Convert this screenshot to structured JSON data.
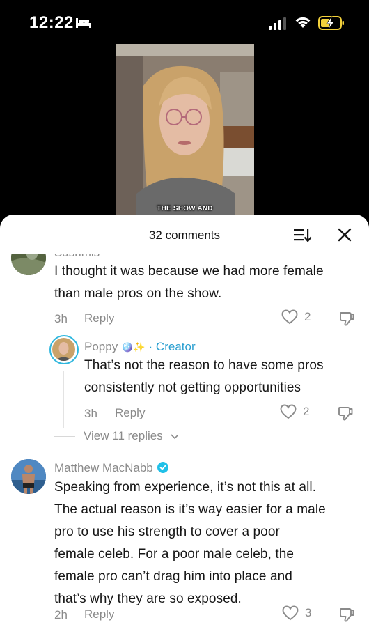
{
  "status_bar": {
    "time": "12:22"
  },
  "video": {
    "caption": "THE SHOW AND"
  },
  "comments_sheet": {
    "count_label": "32 comments",
    "comments": [
      {
        "username": "Sashmis",
        "text_lines": [
          "I thought it was because we had more female",
          "than male pros on the show."
        ],
        "time": "3h",
        "reply_label": "Reply",
        "likes": "2"
      },
      {
        "username": "Poppy",
        "username_emoji": "🪩✨",
        "creator_label": "· Creator",
        "text_lines": [
          "That’s not the reason to have some pros",
          "consistently not getting opportunities"
        ],
        "time": "3h",
        "reply_label": "Reply",
        "likes": "2"
      },
      {
        "username": "Matthew MacNabb",
        "text_lines": [
          "Speaking from experience, it’s not this at all.",
          "The actual reason is it’s way easier for a male",
          "pro to use his strength to cover a poor",
          "female celeb. For a poor male celeb, the",
          "female pro can’t drag him into place and",
          "that’s why they are so exposed."
        ],
        "time": "2h",
        "reply_label": "Reply",
        "likes": "3"
      }
    ],
    "view_replies_label": "View 11 replies"
  },
  "colors": {
    "creator_accent": "#2a9fd0",
    "verified": "#20c0e8"
  }
}
